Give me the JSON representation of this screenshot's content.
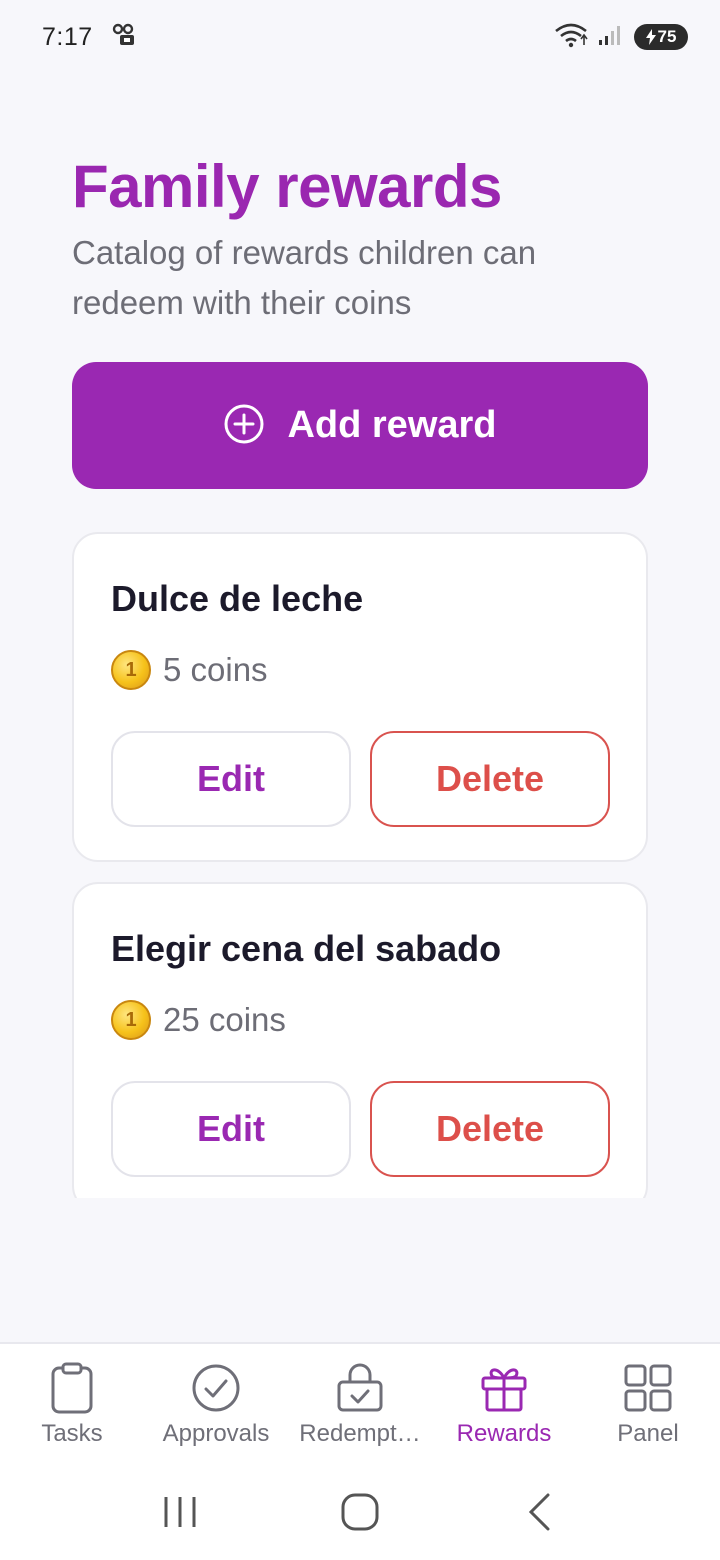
{
  "status_bar": {
    "time": "7:17",
    "battery_level": "75",
    "icons": [
      "voicemail-icon",
      "wifi-icon",
      "signal-icon",
      "battery-charging-icon"
    ]
  },
  "header": {
    "title": "Family rewards",
    "subtitle": "Catalog of rewards children can redeem with their coins"
  },
  "add_button": {
    "label": "Add reward",
    "icon": "plus-circle-icon"
  },
  "rewards": [
    {
      "name": "Dulce de leche",
      "cost": "5 coins",
      "coin_digit": "1",
      "edit_label": "Edit",
      "delete_label": "Delete"
    },
    {
      "name": "Elegir cena del sabado",
      "cost": "25 coins",
      "coin_digit": "1",
      "edit_label": "Edit",
      "delete_label": "Delete"
    }
  ],
  "bottom_nav": {
    "items": [
      {
        "label": "Tasks",
        "icon": "clipboard-icon",
        "active": false
      },
      {
        "label": "Approvals",
        "icon": "check-circle-icon",
        "active": false
      },
      {
        "label": "Redempt…",
        "icon": "lock-check-icon",
        "active": false
      },
      {
        "label": "Rewards",
        "icon": "gift-icon",
        "active": true
      },
      {
        "label": "Panel",
        "icon": "grid-icon",
        "active": false
      }
    ]
  },
  "colors": {
    "accent": "#9a28b2",
    "danger": "#dd4f4a",
    "background": "#f7f7fb",
    "muted_text": "#6d6d76"
  }
}
